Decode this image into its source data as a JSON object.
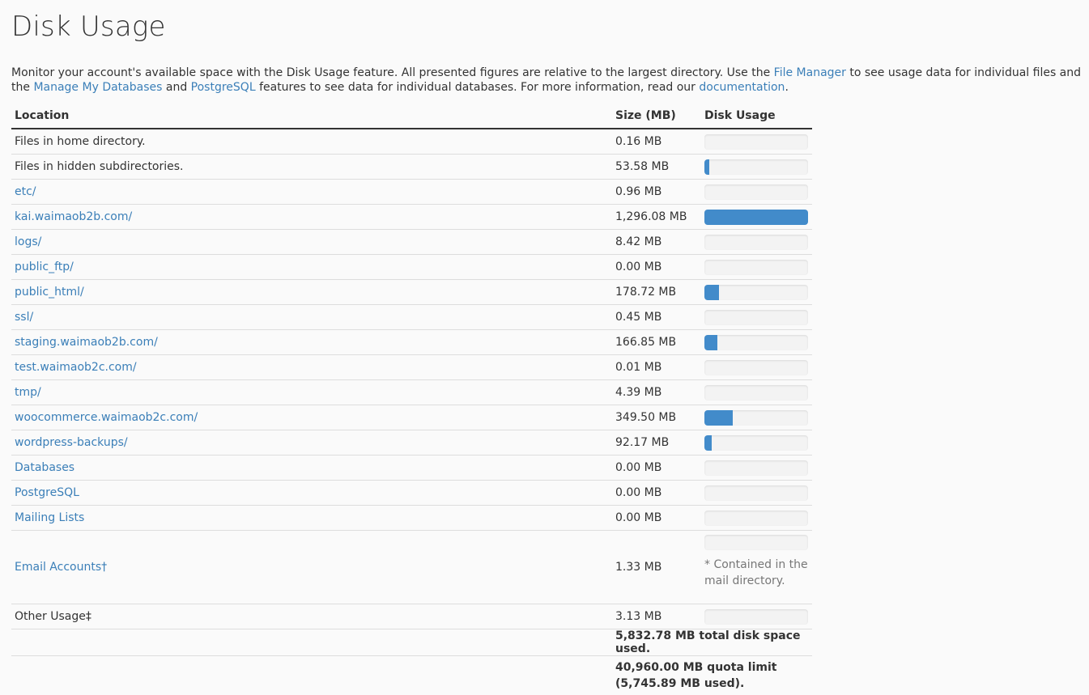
{
  "page": {
    "title": "Disk Usage",
    "description": {
      "part1": "Monitor your account's available space with the Disk Usage feature. All presented figures are relative to the largest directory. Use the ",
      "link_file_manager": "File Manager",
      "part2": " to see usage data for individual files and the ",
      "link_manage_databases": "Manage My Databases",
      "part3": " and ",
      "link_postgresql": "PostgreSQL",
      "part4": " features to see data for individual databases. For more information, read our ",
      "link_documentation": "documentation",
      "part5": "."
    }
  },
  "table": {
    "headers": {
      "location": "Location",
      "size": "Size (MB)",
      "usage": "Disk Usage"
    },
    "rows": [
      {
        "name": "files-home",
        "location": "Files in home directory.",
        "link": false,
        "size": "0.16 MB",
        "ratio": 0.0001
      },
      {
        "name": "files-hidden",
        "location": "Files in hidden subdirectories.",
        "link": false,
        "size": "53.58 MB",
        "ratio": 0.0413
      },
      {
        "name": "etc",
        "location": "etc/",
        "link": true,
        "size": "0.96 MB",
        "ratio": 0.0007
      },
      {
        "name": "kai-waimaob2b",
        "location": "kai.waimaob2b.com/",
        "link": true,
        "size": "1,296.08 MB",
        "ratio": 1.0
      },
      {
        "name": "logs",
        "location": "logs/",
        "link": true,
        "size": "8.42 MB",
        "ratio": 0.0065
      },
      {
        "name": "public-ftp",
        "location": "public_ftp/",
        "link": true,
        "size": "0.00 MB",
        "ratio": 0
      },
      {
        "name": "public-html",
        "location": "public_html/",
        "link": true,
        "size": "178.72 MB",
        "ratio": 0.1379
      },
      {
        "name": "ssl",
        "location": "ssl/",
        "link": true,
        "size": "0.45 MB",
        "ratio": 0.0003
      },
      {
        "name": "staging-waimaob2b",
        "location": "staging.waimaob2b.com/",
        "link": true,
        "size": "166.85 MB",
        "ratio": 0.1287
      },
      {
        "name": "test-waimaob2c",
        "location": "test.waimaob2c.com/",
        "link": true,
        "size": "0.01 MB",
        "ratio": 0
      },
      {
        "name": "tmp",
        "location": "tmp/",
        "link": true,
        "size": "4.39 MB",
        "ratio": 0.0034
      },
      {
        "name": "woocommerce-waimaob2c",
        "location": "woocommerce.waimaob2c.com/",
        "link": true,
        "size": "349.50 MB",
        "ratio": 0.2697
      },
      {
        "name": "wordpress-backups",
        "location": "wordpress-backups/",
        "link": true,
        "size": "92.17 MB",
        "ratio": 0.0711
      },
      {
        "name": "databases",
        "location": "Databases",
        "link": true,
        "size": "0.00 MB",
        "ratio": 0
      },
      {
        "name": "postgresql",
        "location": "PostgreSQL",
        "link": true,
        "size": "0.00 MB",
        "ratio": 0
      },
      {
        "name": "mailing-lists",
        "location": "Mailing Lists",
        "link": true,
        "size": "0.00 MB",
        "ratio": 0
      },
      {
        "name": "email-accounts",
        "location": "Email Accounts†",
        "link": true,
        "size": "1.33 MB",
        "ratio": 0.001,
        "note": "* Contained in the mail directory."
      },
      {
        "name": "other-usage",
        "location": "Other Usage‡",
        "link": false,
        "size": "3.13 MB",
        "ratio": 0.0024
      }
    ],
    "total": "5,832.78 MB total disk space used.",
    "quota": "40,960.00 MB quota limit (5,745.89 MB used)."
  },
  "colors": {
    "link": "#3b7fb8",
    "bar_fill": "#428bca",
    "bar_track": "#f3f3f3"
  }
}
